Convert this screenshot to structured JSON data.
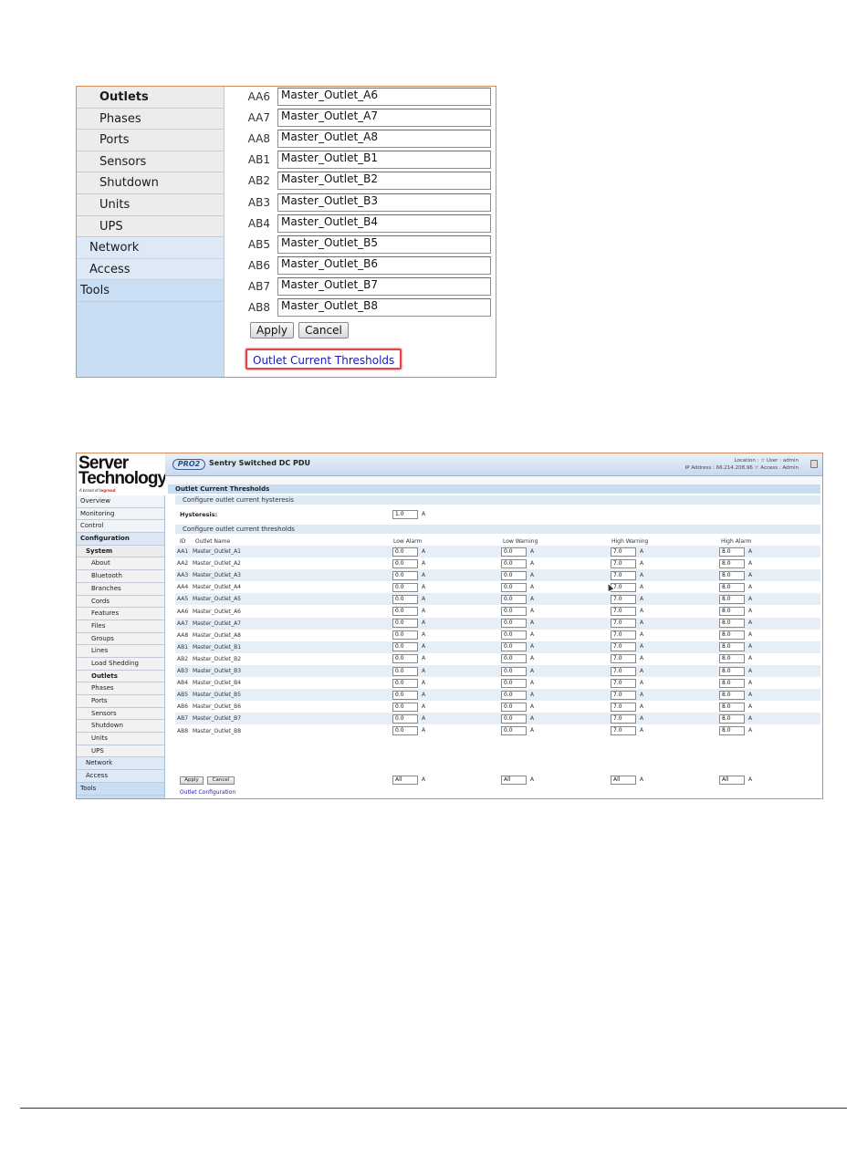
{
  "shot1": {
    "nav": {
      "items": [
        "Outlets",
        "Phases",
        "Ports",
        "Sensors",
        "Shutdown",
        "Units",
        "UPS"
      ],
      "network": "Network",
      "access": "Access",
      "tools": "Tools"
    },
    "rows": [
      {
        "id": "AA6",
        "name": "Master_Outlet_A6"
      },
      {
        "id": "AA7",
        "name": "Master_Outlet_A7"
      },
      {
        "id": "AA8",
        "name": "Master_Outlet_A8"
      },
      {
        "id": "AB1",
        "name": "Master_Outlet_B1"
      },
      {
        "id": "AB2",
        "name": "Master_Outlet_B2"
      },
      {
        "id": "AB3",
        "name": "Master_Outlet_B3"
      },
      {
        "id": "AB4",
        "name": "Master_Outlet_B4"
      },
      {
        "id": "AB5",
        "name": "Master_Outlet_B5"
      },
      {
        "id": "AB6",
        "name": "Master_Outlet_B6"
      },
      {
        "id": "AB7",
        "name": "Master_Outlet_B7"
      },
      {
        "id": "AB8",
        "name": "Master_Outlet_B8"
      }
    ],
    "apply": "Apply",
    "cancel": "Cancel",
    "link": "Outlet Current Thresholds"
  },
  "shot2": {
    "logo": {
      "line1": "Server",
      "line2": "Technology.",
      "tag_prefix": "A brand of ",
      "tag_brand": "legrand"
    },
    "header": {
      "pro": "PRO2",
      "title": "Sentry Switched DC PDU",
      "info_line1": "Location : ☆ User : admin",
      "info_line2": "IP Address : 66.214.208.96 ☆ Access : Admin"
    },
    "sidebar": {
      "overview": "Overview",
      "monitoring": "Monitoring",
      "control": "Control",
      "configuration": "Configuration",
      "system": "System",
      "items": [
        "About",
        "Bluetooth",
        "Branches",
        "Cords",
        "Features",
        "Files",
        "Groups",
        "Lines",
        "Load Shedding",
        "Outlets",
        "Phases",
        "Ports",
        "Sensors",
        "Shutdown",
        "Units",
        "UPS"
      ],
      "network": "Network",
      "access": "Access",
      "tools": "Tools"
    },
    "section_title": "Outlet Current Thresholds",
    "hysteresis_heading": "Configure outlet current hysteresis",
    "hysteresis_label": "Hysteresis:",
    "hysteresis_value": "1.0",
    "thresholds_heading": "Configure outlet current thresholds",
    "columns": {
      "id": "ID",
      "name": "Outlet Name",
      "low_alarm": "Low Alarm",
      "low_warning": "Low Warning",
      "high_warning": "High Warning",
      "high_alarm": "High Alarm"
    },
    "unit": "A",
    "rows": [
      {
        "id": "AA1",
        "name": "Master_Outlet_A1",
        "la": "0.0",
        "lw": "0.0",
        "hw": "7.0",
        "ha": "8.0"
      },
      {
        "id": "AA2",
        "name": "Master_Outlet_A2",
        "la": "0.0",
        "lw": "0.0",
        "hw": "7.0",
        "ha": "8.0"
      },
      {
        "id": "AA3",
        "name": "Master_Outlet_A3",
        "la": "0.0",
        "lw": "0.0",
        "hw": "7.0",
        "ha": "8.0"
      },
      {
        "id": "AA4",
        "name": "Master_Outlet_A4",
        "la": "0.0",
        "lw": "0.0",
        "hw": "7.0",
        "ha": "8.0"
      },
      {
        "id": "AA5",
        "name": "Master_Outlet_A5",
        "la": "0.0",
        "lw": "0.0",
        "hw": "7.0",
        "ha": "8.0"
      },
      {
        "id": "AA6",
        "name": "Master_Outlet_A6",
        "la": "0.0",
        "lw": "0.0",
        "hw": "7.0",
        "ha": "8.0"
      },
      {
        "id": "AA7",
        "name": "Master_Outlet_A7",
        "la": "0.0",
        "lw": "0.0",
        "hw": "7.0",
        "ha": "8.0"
      },
      {
        "id": "AA8",
        "name": "Master_Outlet_A8",
        "la": "0.0",
        "lw": "0.0",
        "hw": "7.0",
        "ha": "8.0"
      },
      {
        "id": "AB1",
        "name": "Master_Outlet_B1",
        "la": "0.0",
        "lw": "0.0",
        "hw": "7.0",
        "ha": "8.0"
      },
      {
        "id": "AB2",
        "name": "Master_Outlet_B2",
        "la": "0.0",
        "lw": "0.0",
        "hw": "7.0",
        "ha": "8.0"
      },
      {
        "id": "AB3",
        "name": "Master_Outlet_B3",
        "la": "0.0",
        "lw": "0.0",
        "hw": "7.0",
        "ha": "8.0"
      },
      {
        "id": "AB4",
        "name": "Master_Outlet_B4",
        "la": "0.0",
        "lw": "0.0",
        "hw": "7.0",
        "ha": "8.0"
      },
      {
        "id": "AB5",
        "name": "Master_Outlet_B5",
        "la": "0.0",
        "lw": "0.0",
        "hw": "7.0",
        "ha": "8.0"
      },
      {
        "id": "AB6",
        "name": "Master_Outlet_B6",
        "la": "0.0",
        "lw": "0.0",
        "hw": "7.0",
        "ha": "8.0"
      },
      {
        "id": "AB7",
        "name": "Master_Outlet_B7",
        "la": "0.0",
        "lw": "0.0",
        "hw": "7.0",
        "ha": "8.0"
      },
      {
        "id": "AB8",
        "name": "Master_Outlet_B8",
        "la": "0.0",
        "lw": "0.0",
        "hw": "7.0",
        "ha": "8.0"
      }
    ],
    "all_value": "All",
    "apply": "Apply",
    "cancel": "Cancel",
    "link": "Outlet Configuration"
  }
}
